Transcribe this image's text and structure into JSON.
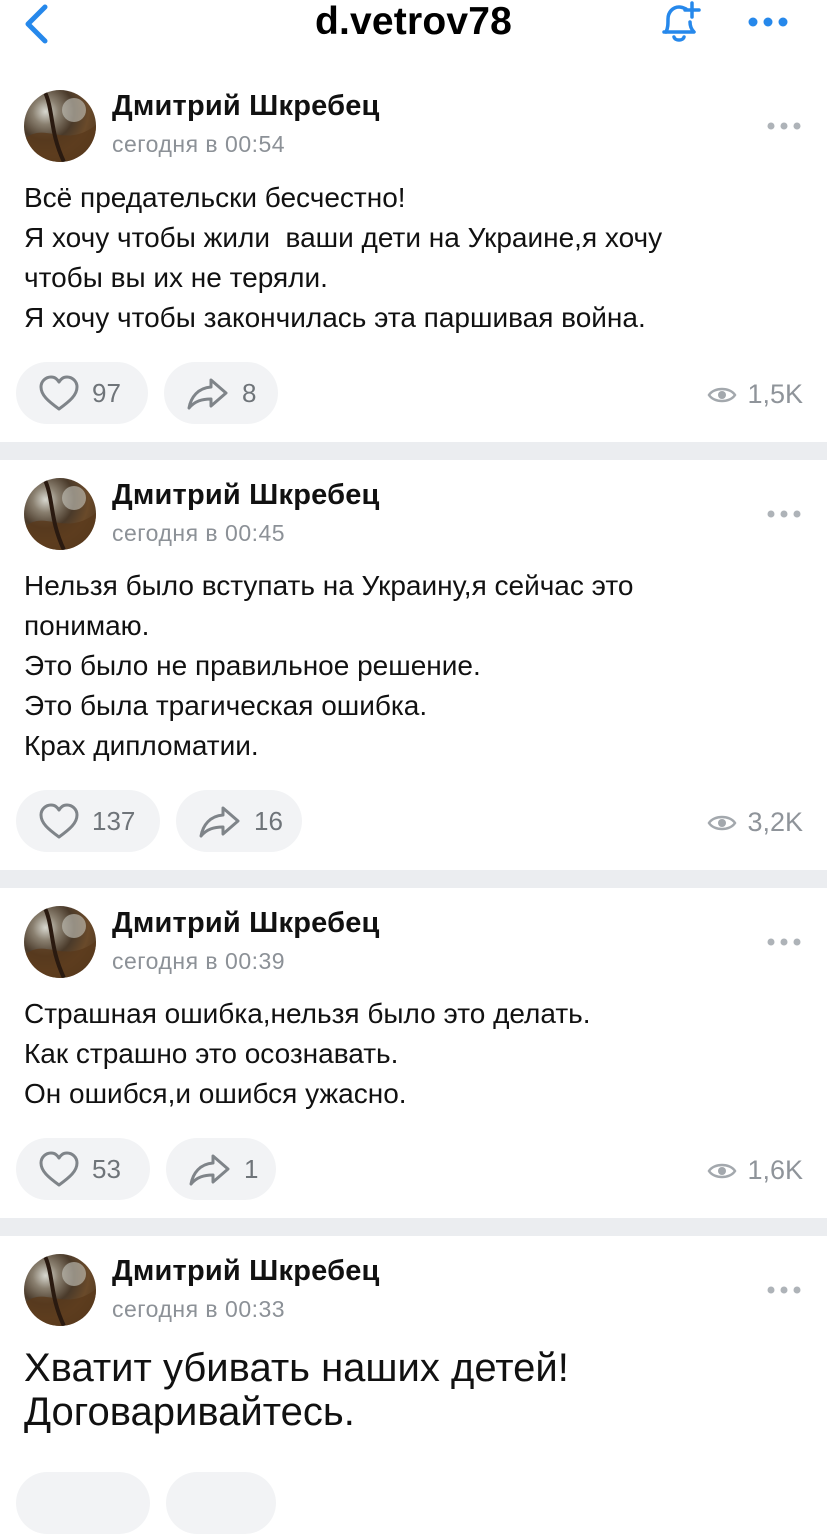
{
  "header": {
    "title": "d.vetrov78"
  },
  "posts": [
    {
      "author": "Дмитрий Шкребец",
      "time": "сегодня в 00:54",
      "lines": [
        "Всё предательски бесчестно!",
        "Я хочу чтобы жили  ваши дети на Украине,я хочу",
        "чтобы вы их не теряли.",
        "Я хочу чтобы закончилась эта паршивая война."
      ],
      "likes": "97",
      "shares": "8",
      "views": "1,5K"
    },
    {
      "author": "Дмитрий Шкребец",
      "time": "сегодня в 00:45",
      "lines": [
        "Нельзя было вступать на Украину,я сейчас это",
        "понимаю.",
        "Это было не правильное решение.",
        "Это была трагическая ошибка.",
        "Крах дипломатии."
      ],
      "likes": "137",
      "shares": "16",
      "views": "3,2K"
    },
    {
      "author": "Дмитрий Шкребец",
      "time": "сегодня в 00:39",
      "lines": [
        "Страшная ошибка,нельзя было это делать.",
        "Как страшно это осознавать.",
        "Он ошибся,и ошибся ужасно."
      ],
      "likes": "53",
      "shares": "1",
      "views": "1,6K"
    },
    {
      "author": "Дмитрий Шкребец",
      "time": "сегодня в 00:33",
      "lines": [
        "Хватит убивать наших детей!",
        "Договаривайтесь."
      ]
    }
  ],
  "icons": {
    "back": "chevron-left-icon",
    "subscribe": "bell-plus-icon",
    "menu": "more-horizontal-icon",
    "like": "heart-icon",
    "share": "share-arrow-icon",
    "views": "eye-icon"
  },
  "colors": {
    "accent": "#2688eb",
    "separator": "#ebedf0",
    "pill": "#f2f3f5",
    "muted": "#8c9197"
  }
}
